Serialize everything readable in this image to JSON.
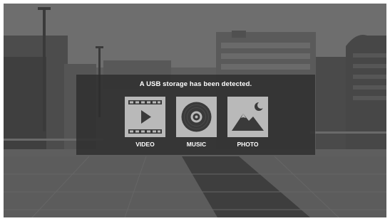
{
  "notification": {
    "message": "A USB storage has been detected."
  },
  "options": [
    {
      "label": "VIDEO",
      "icon": "video-film-icon"
    },
    {
      "label": "MUSIC",
      "icon": "music-disc-icon"
    },
    {
      "label": "PHOTO",
      "icon": "photo-landscape-icon"
    }
  ],
  "colors": {
    "tile": "#b9b9b9",
    "icon": "#3a3a3a",
    "dialog_bg": "#2d2d2d",
    "text": "#ffffff"
  }
}
